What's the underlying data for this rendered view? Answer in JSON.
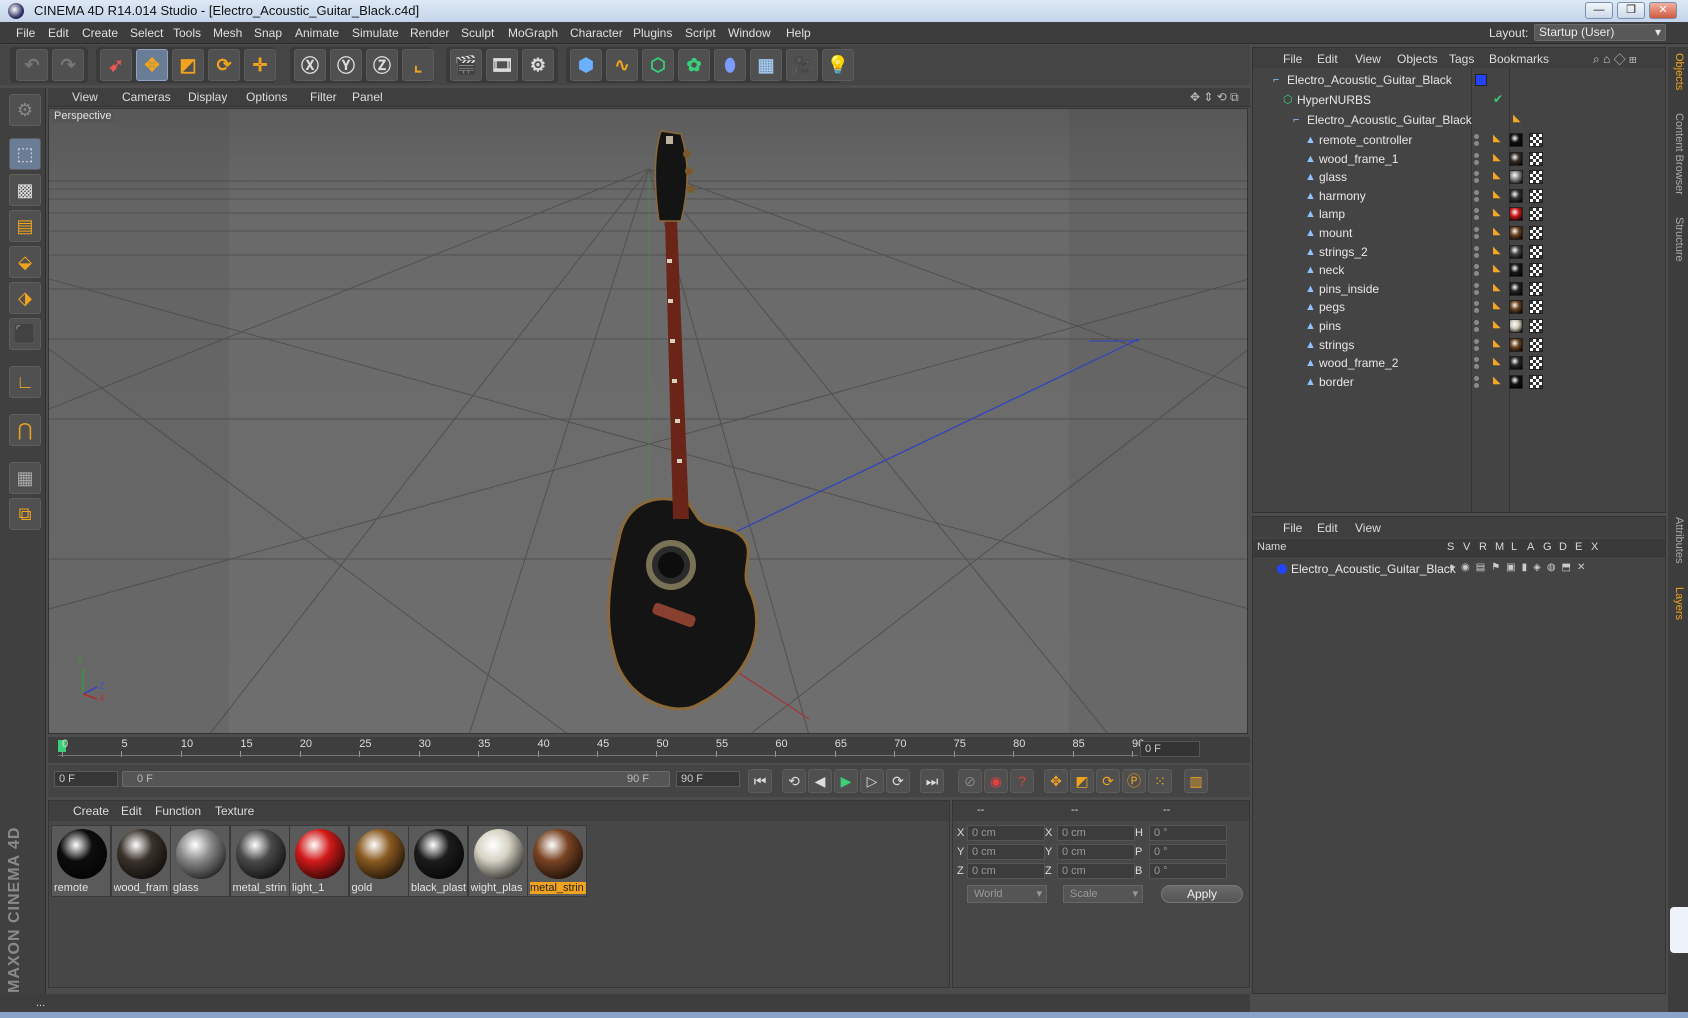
{
  "window": {
    "title": "CINEMA 4D R14.014 Studio - [Electro_Acoustic_Guitar_Black.c4d]",
    "controls": [
      "—",
      "❐",
      "✕"
    ]
  },
  "menu": {
    "items": [
      "File",
      "Edit",
      "Create",
      "Select",
      "Tools",
      "Mesh",
      "Snap",
      "Animate",
      "Simulate",
      "Render",
      "Sculpt",
      "MoGraph",
      "Character",
      "Plugins",
      "Script",
      "Window",
      "Help"
    ],
    "layout_label": "Layout:",
    "layout_value": "Startup (User)"
  },
  "viewport": {
    "menu": [
      "View",
      "Cameras",
      "Display",
      "Options",
      "Filter",
      "Panel"
    ],
    "label": "Perspective",
    "axis_labels": [
      "Y",
      "Z",
      "X"
    ]
  },
  "timeline": {
    "ticks": [
      "0",
      "5",
      "10",
      "15",
      "20",
      "25",
      "30",
      "35",
      "40",
      "45",
      "50",
      "55",
      "60",
      "65",
      "70",
      "75",
      "80",
      "85",
      "90"
    ],
    "current_frame": "0 F"
  },
  "transport": {
    "start_field": "0 F",
    "range_start": "0 F",
    "range_end": "90 F",
    "end_field": "90 F"
  },
  "materials": {
    "menu": [
      "Create",
      "Edit",
      "Function",
      "Texture"
    ],
    "items": [
      {
        "label": "remote",
        "color": "#0d0d0d",
        "active": false
      },
      {
        "label": "wood_fram",
        "color": "#3b332c",
        "active": false
      },
      {
        "label": "glass",
        "color": "#8a8a8a",
        "active": false
      },
      {
        "label": "metal_strin",
        "color": "#4a4a4a",
        "active": false
      },
      {
        "label": "light_1",
        "color": "#d11a1a",
        "active": false
      },
      {
        "label": "gold",
        "color": "#8a5a22",
        "active": false
      },
      {
        "label": "black_plast",
        "color": "#1c1c1c",
        "active": false
      },
      {
        "label": "wight_plas",
        "color": "#d6d3c4",
        "active": false
      },
      {
        "label": "metal_strin",
        "color": "#7a4424",
        "active": true
      }
    ]
  },
  "coords": {
    "header": [
      "--",
      "--",
      "--"
    ],
    "rows": [
      {
        "a": "X",
        "av": "0 cm",
        "b": "X",
        "bv": "0 cm",
        "c": "H",
        "cv": "0 °"
      },
      {
        "a": "Y",
        "av": "0 cm",
        "b": "Y",
        "bv": "0 cm",
        "c": "P",
        "cv": "0 °"
      },
      {
        "a": "Z",
        "av": "0 cm",
        "b": "Z",
        "bv": "0 cm",
        "c": "B",
        "cv": "0 °"
      }
    ],
    "mode_select": "World",
    "scale_select": "Scale",
    "apply": "Apply"
  },
  "objects": {
    "menu": [
      "File",
      "Edit",
      "View",
      "Objects",
      "Tags",
      "Bookmarks"
    ],
    "root": "Electro_Acoustic_Guitar_Black",
    "nurbs": "HyperNURBS",
    "group": "Electro_Acoustic_Guitar_Black",
    "children": [
      {
        "name": "remote_controller",
        "tag": "#111111"
      },
      {
        "name": "wood_frame_1",
        "tag": "#3a302a"
      },
      {
        "name": "glass",
        "tag": "#8a8a8a"
      },
      {
        "name": "harmony",
        "tag": "#333333"
      },
      {
        "name": "lamp",
        "tag": "#cc1a1a"
      },
      {
        "name": "mount",
        "tag": "#6b4422"
      },
      {
        "name": "strings_2",
        "tag": "#444444"
      },
      {
        "name": "neck",
        "tag": "#1a1a1a"
      },
      {
        "name": "pins_inside",
        "tag": "#222222"
      },
      {
        "name": "pegs",
        "tag": "#6b4422"
      },
      {
        "name": "pins",
        "tag": "#cfcab8"
      },
      {
        "name": "strings",
        "tag": "#6b4422"
      },
      {
        "name": "wood_frame_2",
        "tag": "#2a2a2a"
      },
      {
        "name": "border",
        "tag": "#111111"
      }
    ]
  },
  "layers": {
    "menu": [
      "File",
      "Edit",
      "View"
    ],
    "columns": [
      "Name",
      "S",
      "V",
      "R",
      "M",
      "L",
      "A",
      "G",
      "D",
      "E",
      "X"
    ],
    "row": "Electro_Acoustic_Guitar_Black"
  },
  "sidetabs": [
    "Objects",
    "Content Browser",
    "Structure",
    "Attributes",
    "Layers"
  ],
  "status": {
    "text": "..."
  },
  "logo": "MAXON CINEMA 4D",
  "colors": {
    "accent": "#f0a41e",
    "selected_tool": "#6a7d96",
    "layer_color": "#2244ff"
  }
}
